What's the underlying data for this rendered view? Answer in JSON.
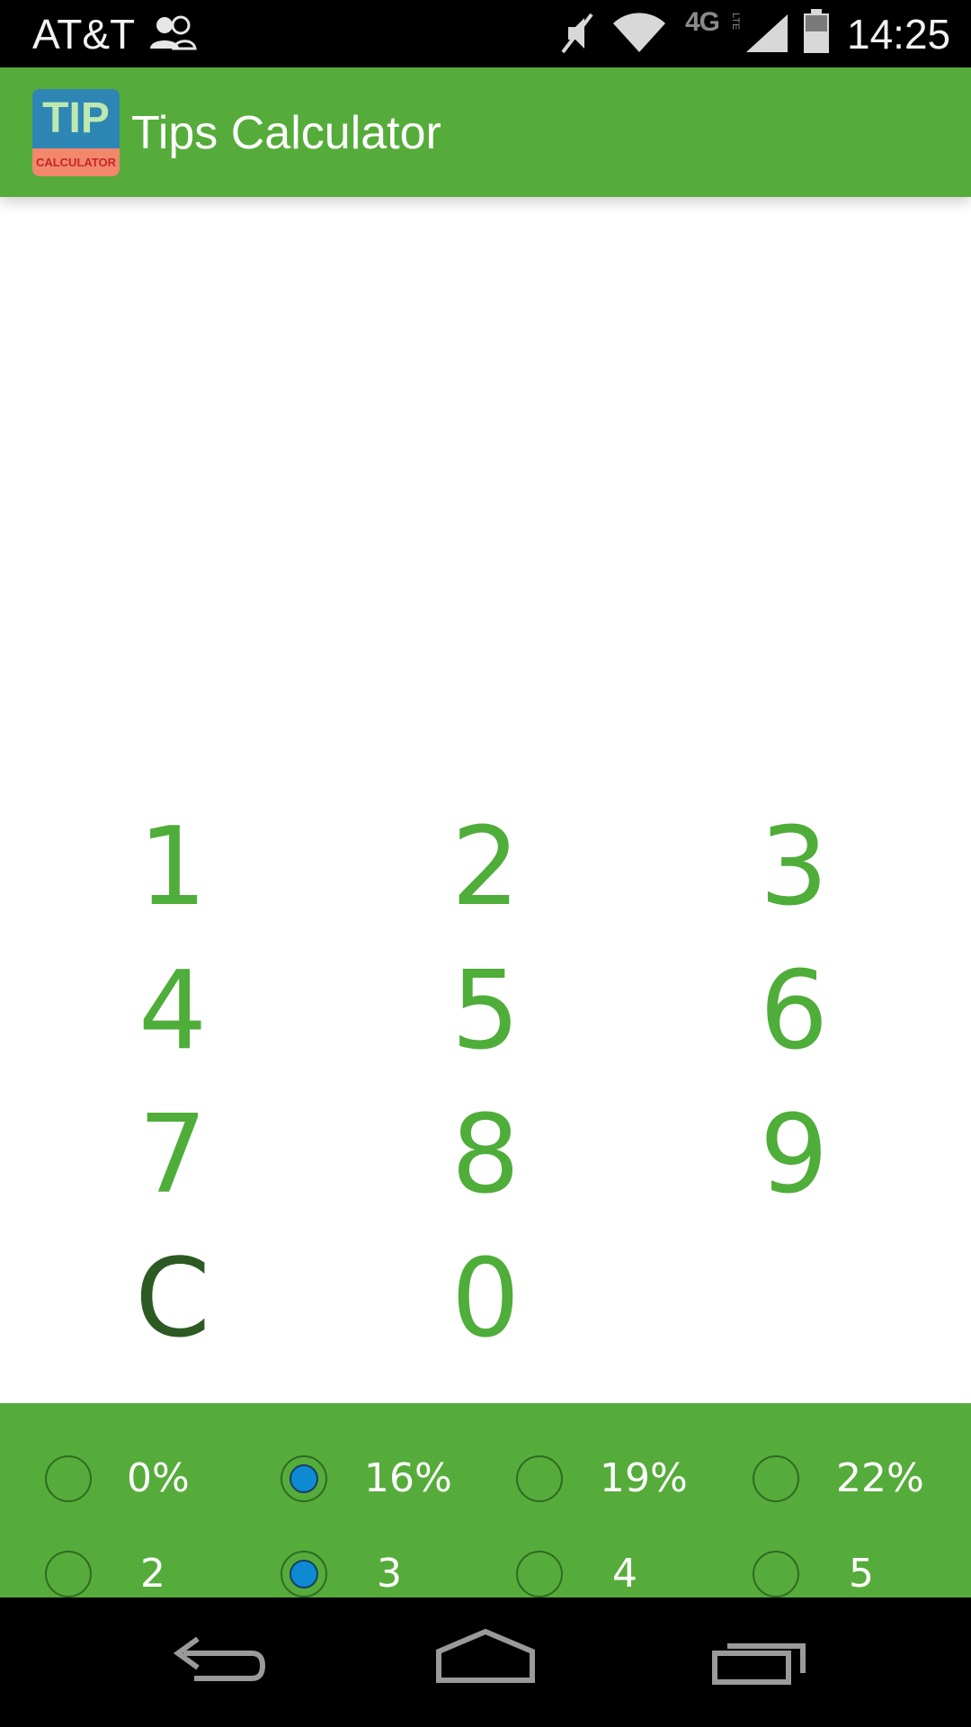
{
  "status_bar": {
    "carrier": "AT&T",
    "network": "4G",
    "network_sub": "LTE",
    "time": "14:25",
    "icons": [
      "contacts-icon",
      "mute-icon",
      "wifi-icon",
      "signal-icon",
      "battery-icon"
    ]
  },
  "app_bar": {
    "logo_main": "TIP",
    "logo_sub": "CALCULATOR",
    "title": "Tips Calculator"
  },
  "keypad": {
    "rows": [
      [
        "1",
        "2",
        "3"
      ],
      [
        "4",
        "5",
        "6"
      ],
      [
        "7",
        "8",
        "9"
      ],
      [
        "C",
        "0",
        ""
      ]
    ]
  },
  "tip_options": [
    {
      "label": "0%",
      "selected": false
    },
    {
      "label": "16%",
      "selected": true
    },
    {
      "label": "19%",
      "selected": false
    },
    {
      "label": "22%",
      "selected": false
    }
  ],
  "split_options": [
    {
      "label": "2",
      "selected": false
    },
    {
      "label": "3",
      "selected": true
    },
    {
      "label": "4",
      "selected": false
    },
    {
      "label": "5",
      "selected": false
    }
  ],
  "colors": {
    "brand_green": "#55ac3a",
    "key_green": "#4fad3a",
    "clear_key": "#2c5a22",
    "radio_selected": "#0e8ad3"
  },
  "nav_bar": {
    "buttons": [
      "back-icon",
      "home-icon",
      "recents-icon"
    ]
  }
}
